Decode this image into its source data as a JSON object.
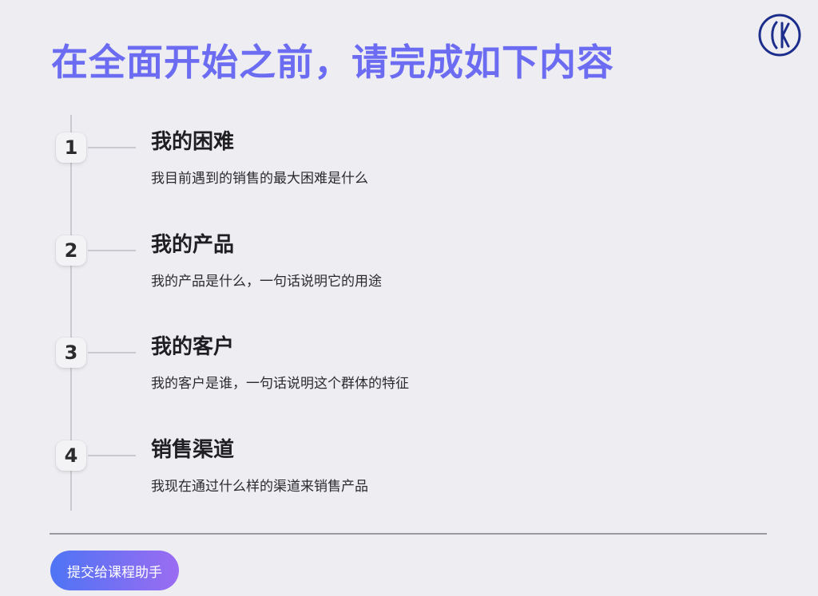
{
  "page": {
    "title": "在全面开始之前，请完成如下内容"
  },
  "logo": {
    "icon": "brand-logo-icon",
    "color": "#1d2d8c"
  },
  "colors": {
    "title": "#6b6cf2",
    "button_gradient_start": "#4e74f4",
    "button_gradient_end": "#9b6cf2"
  },
  "steps": [
    {
      "number": "1",
      "title": "我的困难",
      "description": "我目前遇到的销售的最大困难是什么"
    },
    {
      "number": "2",
      "title": "我的产品",
      "description": "我的产品是什么，一句话说明它的用途"
    },
    {
      "number": "3",
      "title": "我的客户",
      "description": "我的客户是谁，一句话说明这个群体的特征"
    },
    {
      "number": "4",
      "title": "销售渠道",
      "description": "我现在通过什么样的渠道来销售产品"
    }
  ],
  "footer": {
    "submit_label": "提交给课程助手"
  }
}
